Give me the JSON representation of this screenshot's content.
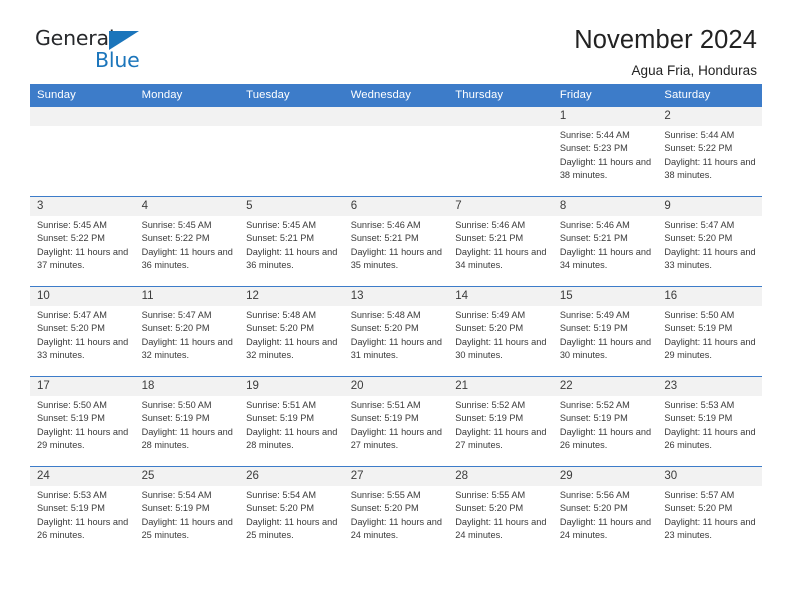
{
  "logo": {
    "word1": "General",
    "word2": "Blue",
    "triangle_color": "#1b75bb"
  },
  "header": {
    "month_title": "November 2024",
    "location": "Agua Fria, Honduras"
  },
  "calendar": {
    "header_color": "#3d7cc9",
    "weekday_headers": [
      "Sunday",
      "Monday",
      "Tuesday",
      "Wednesday",
      "Thursday",
      "Friday",
      "Saturday"
    ],
    "labels": {
      "sunrise": "Sunrise:",
      "sunset": "Sunset:",
      "daylight": "Daylight:"
    },
    "weeks": [
      [
        {
          "empty": true
        },
        {
          "empty": true
        },
        {
          "empty": true
        },
        {
          "empty": true
        },
        {
          "empty": true
        },
        {
          "day": "1",
          "sunrise": "Sunrise: 5:44 AM",
          "sunset": "Sunset: 5:23 PM",
          "daylight": "Daylight: 11 hours and 38 minutes."
        },
        {
          "day": "2",
          "sunrise": "Sunrise: 5:44 AM",
          "sunset": "Sunset: 5:22 PM",
          "daylight": "Daylight: 11 hours and 38 minutes."
        }
      ],
      [
        {
          "day": "3",
          "sunrise": "Sunrise: 5:45 AM",
          "sunset": "Sunset: 5:22 PM",
          "daylight": "Daylight: 11 hours and 37 minutes."
        },
        {
          "day": "4",
          "sunrise": "Sunrise: 5:45 AM",
          "sunset": "Sunset: 5:22 PM",
          "daylight": "Daylight: 11 hours and 36 minutes."
        },
        {
          "day": "5",
          "sunrise": "Sunrise: 5:45 AM",
          "sunset": "Sunset: 5:21 PM",
          "daylight": "Daylight: 11 hours and 36 minutes."
        },
        {
          "day": "6",
          "sunrise": "Sunrise: 5:46 AM",
          "sunset": "Sunset: 5:21 PM",
          "daylight": "Daylight: 11 hours and 35 minutes."
        },
        {
          "day": "7",
          "sunrise": "Sunrise: 5:46 AM",
          "sunset": "Sunset: 5:21 PM",
          "daylight": "Daylight: 11 hours and 34 minutes."
        },
        {
          "day": "8",
          "sunrise": "Sunrise: 5:46 AM",
          "sunset": "Sunset: 5:21 PM",
          "daylight": "Daylight: 11 hours and 34 minutes."
        },
        {
          "day": "9",
          "sunrise": "Sunrise: 5:47 AM",
          "sunset": "Sunset: 5:20 PM",
          "daylight": "Daylight: 11 hours and 33 minutes."
        }
      ],
      [
        {
          "day": "10",
          "sunrise": "Sunrise: 5:47 AM",
          "sunset": "Sunset: 5:20 PM",
          "daylight": "Daylight: 11 hours and 33 minutes."
        },
        {
          "day": "11",
          "sunrise": "Sunrise: 5:47 AM",
          "sunset": "Sunset: 5:20 PM",
          "daylight": "Daylight: 11 hours and 32 minutes."
        },
        {
          "day": "12",
          "sunrise": "Sunrise: 5:48 AM",
          "sunset": "Sunset: 5:20 PM",
          "daylight": "Daylight: 11 hours and 32 minutes."
        },
        {
          "day": "13",
          "sunrise": "Sunrise: 5:48 AM",
          "sunset": "Sunset: 5:20 PM",
          "daylight": "Daylight: 11 hours and 31 minutes."
        },
        {
          "day": "14",
          "sunrise": "Sunrise: 5:49 AM",
          "sunset": "Sunset: 5:20 PM",
          "daylight": "Daylight: 11 hours and 30 minutes."
        },
        {
          "day": "15",
          "sunrise": "Sunrise: 5:49 AM",
          "sunset": "Sunset: 5:19 PM",
          "daylight": "Daylight: 11 hours and 30 minutes."
        },
        {
          "day": "16",
          "sunrise": "Sunrise: 5:50 AM",
          "sunset": "Sunset: 5:19 PM",
          "daylight": "Daylight: 11 hours and 29 minutes."
        }
      ],
      [
        {
          "day": "17",
          "sunrise": "Sunrise: 5:50 AM",
          "sunset": "Sunset: 5:19 PM",
          "daylight": "Daylight: 11 hours and 29 minutes."
        },
        {
          "day": "18",
          "sunrise": "Sunrise: 5:50 AM",
          "sunset": "Sunset: 5:19 PM",
          "daylight": "Daylight: 11 hours and 28 minutes."
        },
        {
          "day": "19",
          "sunrise": "Sunrise: 5:51 AM",
          "sunset": "Sunset: 5:19 PM",
          "daylight": "Daylight: 11 hours and 28 minutes."
        },
        {
          "day": "20",
          "sunrise": "Sunrise: 5:51 AM",
          "sunset": "Sunset: 5:19 PM",
          "daylight": "Daylight: 11 hours and 27 minutes."
        },
        {
          "day": "21",
          "sunrise": "Sunrise: 5:52 AM",
          "sunset": "Sunset: 5:19 PM",
          "daylight": "Daylight: 11 hours and 27 minutes."
        },
        {
          "day": "22",
          "sunrise": "Sunrise: 5:52 AM",
          "sunset": "Sunset: 5:19 PM",
          "daylight": "Daylight: 11 hours and 26 minutes."
        },
        {
          "day": "23",
          "sunrise": "Sunrise: 5:53 AM",
          "sunset": "Sunset: 5:19 PM",
          "daylight": "Daylight: 11 hours and 26 minutes."
        }
      ],
      [
        {
          "day": "24",
          "sunrise": "Sunrise: 5:53 AM",
          "sunset": "Sunset: 5:19 PM",
          "daylight": "Daylight: 11 hours and 26 minutes."
        },
        {
          "day": "25",
          "sunrise": "Sunrise: 5:54 AM",
          "sunset": "Sunset: 5:19 PM",
          "daylight": "Daylight: 11 hours and 25 minutes."
        },
        {
          "day": "26",
          "sunrise": "Sunrise: 5:54 AM",
          "sunset": "Sunset: 5:20 PM",
          "daylight": "Daylight: 11 hours and 25 minutes."
        },
        {
          "day": "27",
          "sunrise": "Sunrise: 5:55 AM",
          "sunset": "Sunset: 5:20 PM",
          "daylight": "Daylight: 11 hours and 24 minutes."
        },
        {
          "day": "28",
          "sunrise": "Sunrise: 5:55 AM",
          "sunset": "Sunset: 5:20 PM",
          "daylight": "Daylight: 11 hours and 24 minutes."
        },
        {
          "day": "29",
          "sunrise": "Sunrise: 5:56 AM",
          "sunset": "Sunset: 5:20 PM",
          "daylight": "Daylight: 11 hours and 24 minutes."
        },
        {
          "day": "30",
          "sunrise": "Sunrise: 5:57 AM",
          "sunset": "Sunset: 5:20 PM",
          "daylight": "Daylight: 11 hours and 23 minutes."
        }
      ]
    ]
  }
}
